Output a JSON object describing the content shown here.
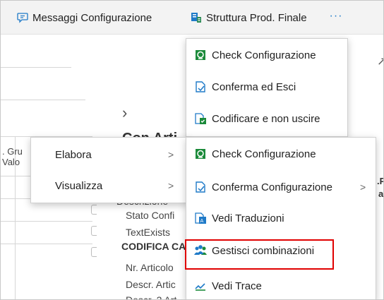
{
  "topbar": {
    "messages_label": "Messaggi Configurazione",
    "structure_label": "Struttura Prod. Finale",
    "more_label": "···"
  },
  "background": {
    "col_gru": ". Gru",
    "col_valo": "Valo",
    "partial_heading": "Con Arti",
    "right_partial_1": ".P",
    "right_partial_2": "a",
    "fields": [
      "Descrizione",
      "Stato Confi",
      "TextExists"
    ],
    "section_heading": "CODIFICA CA",
    "fields2": [
      "Nr. Articolo",
      "Descr. Artic",
      "Descr. 2 Art"
    ]
  },
  "top_menu": {
    "items": [
      {
        "label": "Check Configurazione",
        "icon": "check-config-icon"
      },
      {
        "label": "Conferma ed Esci",
        "icon": "confirm-exit-icon"
      },
      {
        "label": "Codificare e non uscire",
        "icon": "encode-icon"
      }
    ]
  },
  "context_menu": {
    "items": [
      {
        "label": "Elabora"
      },
      {
        "label": "Visualizza"
      }
    ]
  },
  "submenu": {
    "items": [
      {
        "label": "Check Configurazione",
        "icon": "check-config-icon"
      },
      {
        "label": "Conferma Configurazione",
        "icon": "confirm-config-icon"
      },
      {
        "label": "Vedi Traduzioni",
        "icon": "translations-icon"
      },
      {
        "label": "Gestisci combinazioni",
        "icon": "people-icon"
      },
      {
        "label": "Vedi Trace",
        "icon": "trace-icon"
      }
    ]
  },
  "colors": {
    "accent": "#1f7ac8",
    "highlight_border": "#e00000",
    "icon_green": "#1b8a3a"
  }
}
